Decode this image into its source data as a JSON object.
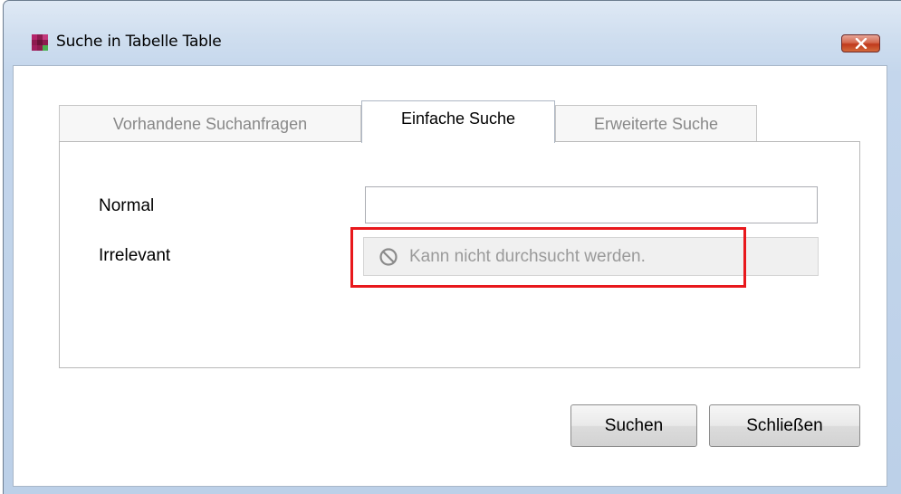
{
  "window": {
    "title": "Suche in Tabelle Table"
  },
  "tabs": [
    {
      "label": "Vorhandene Suchanfragen",
      "active": false
    },
    {
      "label": "Einfache Suche",
      "active": true
    },
    {
      "label": "Erweiterte Suche",
      "active": false
    }
  ],
  "form": {
    "normal_label": "Normal",
    "normal_value": "",
    "irrelevant_label": "Irrelevant",
    "irrelevant_placeholder": "Kann nicht durchsucht werden."
  },
  "buttons": {
    "search": "Suchen",
    "close": "Schließen"
  },
  "colors": {
    "highlight": "#e8181c",
    "close_button": "#c0391c",
    "app_icon": "#9b1b5a"
  },
  "icons": {
    "app": "app-icon",
    "close": "close-icon",
    "disabled": "no-entry-icon"
  }
}
